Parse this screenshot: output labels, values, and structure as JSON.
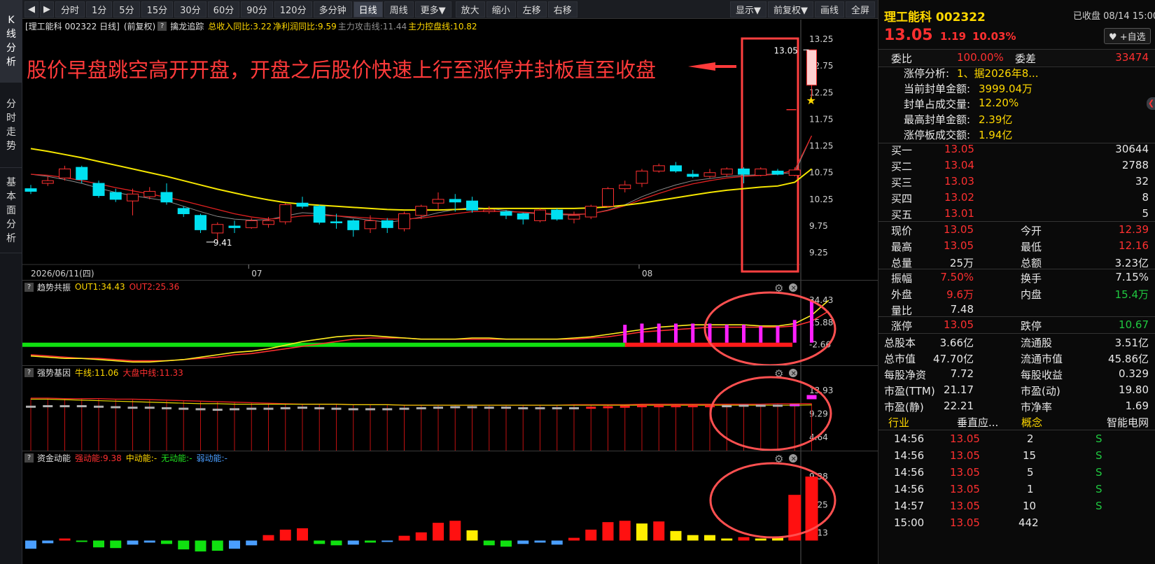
{
  "rail": {
    "items": [
      {
        "label": "K线分析",
        "chars": [
          "K",
          "线",
          "分",
          "析"
        ],
        "active": true
      },
      {
        "label": "分时走势",
        "chars": [
          "分",
          "时",
          "走",
          "势"
        ],
        "active": false
      },
      {
        "label": "基本面分析",
        "chars": [
          "基",
          "本",
          "面",
          "分",
          "析"
        ],
        "active": false
      }
    ]
  },
  "toolbar": {
    "periods": [
      "分时",
      "1分",
      "5分",
      "15分",
      "30分",
      "60分",
      "90分",
      "120分",
      "多分钟",
      "日线",
      "周线",
      "更多▼"
    ],
    "active_period": "日线",
    "actions": [
      "放大",
      "缩小",
      "左移",
      "右移"
    ],
    "right_actions": [
      "显示▼",
      "前复权▼",
      "画线",
      "全屏"
    ]
  },
  "header": {
    "stock": "[理工能科 002322 日线]",
    "adjust": "(前复权)",
    "indicator_name": "擒龙追踪",
    "values": [
      {
        "label": "总收入同比:3.22",
        "color": "#ffd800"
      },
      {
        "label": "净利润同比:9.59",
        "color": "#ffd800"
      },
      {
        "label": "主力攻击线:11.44",
        "color": "#909090"
      },
      {
        "label": "主力控盘线:10.82",
        "color": "#ffd800"
      }
    ]
  },
  "annotation": {
    "text": "股价早盘跳空高开开盘，开盘之后股价快速上行至涨停并封板直至收盘",
    "color": "#ff3a3a"
  },
  "chart_data": [
    {
      "type": "candlestick",
      "title": "理工能科 002322 日线",
      "ylim": [
        9.2,
        13.25
      ],
      "yticks": [
        13.25,
        12.75,
        12.25,
        11.75,
        11.25,
        10.75,
        10.25,
        9.75,
        9.25
      ],
      "xlabels": [
        {
          "i": 0,
          "label": "2026/06/11(四)"
        },
        {
          "i": 13,
          "label": "07"
        },
        {
          "i": 36,
          "label": "08"
        }
      ],
      "low_label": {
        "i": 11,
        "value": "9.41"
      },
      "last_label": "13.05",
      "candles": [
        {
          "o": 10.45,
          "c": 10.4,
          "h": 10.52,
          "l": 10.35
        },
        {
          "o": 10.55,
          "c": 10.6,
          "h": 10.68,
          "l": 10.5
        },
        {
          "o": 10.65,
          "c": 10.82,
          "h": 10.88,
          "l": 10.6
        },
        {
          "o": 10.85,
          "c": 10.62,
          "h": 10.88,
          "l": 10.55
        },
        {
          "o": 10.55,
          "c": 10.32,
          "h": 10.6,
          "l": 10.28
        },
        {
          "o": 10.38,
          "c": 10.25,
          "h": 10.45,
          "l": 10.2
        },
        {
          "o": 10.22,
          "c": 10.35,
          "h": 10.45,
          "l": 9.95
        },
        {
          "o": 10.3,
          "c": 10.4,
          "h": 10.48,
          "l": 10.25
        },
        {
          "o": 10.38,
          "c": 10.2,
          "h": 10.55,
          "l": 10.15
        },
        {
          "o": 10.08,
          "c": 9.98,
          "h": 10.12,
          "l": 9.92
        },
        {
          "o": 9.95,
          "c": 9.68,
          "h": 9.98,
          "l": 9.62
        },
        {
          "o": 9.62,
          "c": 9.78,
          "h": 9.82,
          "l": 9.45
        },
        {
          "o": 9.75,
          "c": 9.72,
          "h": 9.85,
          "l": 9.62
        },
        {
          "o": 9.72,
          "c": 9.85,
          "h": 9.9,
          "l": 9.7
        },
        {
          "o": 9.78,
          "c": 9.85,
          "h": 9.92,
          "l": 9.72
        },
        {
          "o": 9.83,
          "c": 10.15,
          "h": 10.18,
          "l": 9.78
        },
        {
          "o": 10.18,
          "c": 10.12,
          "h": 10.3,
          "l": 10.08
        },
        {
          "o": 10.12,
          "c": 9.82,
          "h": 10.15,
          "l": 9.78
        },
        {
          "o": 9.83,
          "c": 9.82,
          "h": 9.98,
          "l": 9.7
        },
        {
          "o": 9.85,
          "c": 9.68,
          "h": 9.88,
          "l": 9.55
        },
        {
          "o": 9.7,
          "c": 9.85,
          "h": 9.95,
          "l": 9.62
        },
        {
          "o": 9.85,
          "c": 9.72,
          "h": 9.9,
          "l": 9.62
        },
        {
          "o": 9.7,
          "c": 9.98,
          "h": 10.02,
          "l": 9.65
        },
        {
          "o": 9.95,
          "c": 10.12,
          "h": 10.15,
          "l": 9.88
        },
        {
          "o": 10.18,
          "c": 10.25,
          "h": 10.38,
          "l": 10.05
        },
        {
          "o": 10.25,
          "c": 10.2,
          "h": 10.35,
          "l": 10.02
        },
        {
          "o": 10.22,
          "c": 10.05,
          "h": 10.3,
          "l": 10.0
        },
        {
          "o": 10.02,
          "c": 10.05,
          "h": 10.12,
          "l": 9.98
        },
        {
          "o": 10.02,
          "c": 9.95,
          "h": 10.05,
          "l": 9.88
        },
        {
          "o": 9.98,
          "c": 9.88,
          "h": 10.0,
          "l": 9.78
        },
        {
          "o": 9.85,
          "c": 10.05,
          "h": 10.08,
          "l": 9.82
        },
        {
          "o": 10.05,
          "c": 9.88,
          "h": 10.08,
          "l": 9.85
        },
        {
          "o": 9.88,
          "c": 9.95,
          "h": 10.02,
          "l": 9.8
        },
        {
          "o": 9.92,
          "c": 10.12,
          "h": 10.15,
          "l": 9.88
        },
        {
          "o": 10.12,
          "c": 10.45,
          "h": 10.48,
          "l": 10.1
        },
        {
          "o": 10.45,
          "c": 10.52,
          "h": 10.6,
          "l": 10.38
        },
        {
          "o": 10.55,
          "c": 10.78,
          "h": 10.82,
          "l": 10.48
        },
        {
          "o": 10.78,
          "c": 10.88,
          "h": 10.92,
          "l": 10.75
        },
        {
          "o": 10.88,
          "c": 10.78,
          "h": 10.95,
          "l": 10.75
        },
        {
          "o": 10.72,
          "c": 10.68,
          "h": 10.8,
          "l": 10.65
        },
        {
          "o": 10.68,
          "c": 10.75,
          "h": 10.82,
          "l": 10.65
        },
        {
          "o": 10.72,
          "c": 10.82,
          "h": 10.85,
          "l": 10.68
        },
        {
          "o": 10.82,
          "c": 10.72,
          "h": 10.85,
          "l": 10.55
        },
        {
          "o": 10.7,
          "c": 10.82,
          "h": 10.85,
          "l": 10.68
        },
        {
          "o": 10.78,
          "c": 10.72,
          "h": 10.82,
          "l": 10.7
        },
        {
          "o": 10.7,
          "c": 10.8,
          "h": 10.85,
          "l": 10.68
        },
        {
          "o": 12.39,
          "c": 13.05,
          "h": 13.05,
          "l": 12.16
        }
      ],
      "ma_white": [
        10.72,
        10.68,
        10.62,
        10.55,
        10.46,
        10.38,
        10.32,
        10.27,
        10.22,
        10.12,
        10.02,
        9.93,
        9.88,
        9.86,
        9.87,
        9.94,
        10.0,
        9.98,
        9.94,
        9.9,
        9.86,
        9.82,
        9.86,
        9.92,
        10.0,
        10.06,
        10.1,
        10.08,
        10.04,
        10.0,
        9.98,
        9.96,
        9.96,
        9.98,
        10.05,
        10.15,
        10.3,
        10.42,
        10.52,
        10.6,
        10.64,
        10.68,
        10.7,
        10.71,
        10.73,
        10.75,
        11.44
      ],
      "ma_red": [
        10.72,
        10.7,
        10.66,
        10.6,
        10.54,
        10.47,
        10.41,
        10.35,
        10.29,
        10.22,
        10.14,
        10.06,
        9.98,
        9.92,
        9.88,
        9.9,
        9.94,
        9.95,
        9.94,
        9.92,
        9.9,
        9.88,
        9.88,
        9.9,
        9.94,
        9.98,
        10.02,
        10.03,
        10.02,
        10.01,
        9.99,
        9.98,
        9.97,
        9.98,
        10.04,
        10.13,
        10.25,
        10.36,
        10.46,
        10.54,
        10.6,
        10.65,
        10.68,
        10.7,
        10.72,
        10.8,
        11.44
      ],
      "ma_yellow": [
        11.2,
        11.15,
        11.09,
        11.03,
        10.96,
        10.89,
        10.82,
        10.75,
        10.68,
        10.6,
        10.52,
        10.44,
        10.37,
        10.3,
        10.24,
        10.19,
        10.16,
        10.14,
        10.12,
        10.1,
        10.08,
        10.06,
        10.05,
        10.05,
        10.05,
        10.06,
        10.07,
        10.08,
        10.08,
        10.08,
        10.08,
        10.08,
        10.08,
        10.09,
        10.11,
        10.14,
        10.18,
        10.23,
        10.28,
        10.33,
        10.38,
        10.42,
        10.45,
        10.48,
        10.5,
        10.57,
        10.82
      ]
    },
    {
      "type": "bar",
      "title": "趋势共振",
      "legend": [
        {
          "name": "OUT1:34.43",
          "color": "#ffd800"
        },
        {
          "name": "OUT2:25.36",
          "color": "#ff3030"
        }
      ],
      "ylim": [
        -10,
        40
      ],
      "yticks": [
        34.43,
        15.88,
        -2.66
      ],
      "out1": [
        -12,
        -13,
        -14,
        -14,
        -15,
        -16,
        -17,
        -17,
        -16,
        -15,
        -13,
        -11,
        -9,
        -8,
        -6,
        -3,
        0,
        2,
        4,
        5,
        5,
        4,
        3,
        2,
        2,
        2,
        3,
        3,
        2,
        2,
        2,
        2,
        3,
        4,
        6,
        8,
        10,
        12,
        13,
        14,
        14,
        14,
        14,
        13,
        13,
        15,
        22,
        34.43
      ],
      "out2": [
        -11,
        -12,
        -13,
        -14,
        -14,
        -15,
        -16,
        -16,
        -16,
        -15,
        -14,
        -13,
        -11,
        -10,
        -8,
        -6,
        -4,
        -2,
        0,
        2,
        3,
        3,
        3,
        2,
        2,
        2,
        2,
        2,
        2,
        2,
        2,
        2,
        2,
        3,
        4,
        6,
        8,
        9,
        10,
        11,
        12,
        12,
        12,
        12,
        12,
        13,
        17,
        25.36
      ],
      "bars": [
        14,
        15,
        15,
        15,
        15,
        15,
        14,
        14,
        13,
        13,
        18,
        34.43
      ],
      "bars_start": 35
    },
    {
      "type": "bar",
      "title": "强势基因",
      "legend": [
        {
          "name": "牛线:11.06",
          "color": "#ffd800"
        },
        {
          "name": "大盘中线:11.33",
          "color": "#ff3030"
        }
      ],
      "ylim": [
        2,
        16
      ],
      "yticks": [
        13.93,
        9.29,
        4.64
      ],
      "line_yellow": [
        12.2,
        12.2,
        12.1,
        12.0,
        11.9,
        11.8,
        11.7,
        11.6,
        11.5,
        11.4,
        11.3,
        11.3,
        11.2,
        11.2,
        11.2,
        11.2,
        11.2,
        11.2,
        11.2,
        11.1,
        11.1,
        11.1,
        11.0,
        11.0,
        11.0,
        11.0,
        11.0,
        11.0,
        11.0,
        11.0,
        11.0,
        11.0,
        11.0,
        11.0,
        11.0,
        11.0,
        11.0,
        11.0,
        11.0,
        11.0,
        11.0,
        11.0,
        11.0,
        11.0,
        11.0,
        11.0,
        11.06
      ],
      "line_red": [
        12.4,
        12.4,
        12.3,
        12.3,
        12.3,
        12.2,
        12.2,
        12.1,
        12.0,
        11.9,
        11.8,
        11.7,
        11.6,
        11.5,
        11.4,
        11.3,
        11.2,
        11.2,
        11.2,
        11.1,
        11.1,
        11.1,
        11.0,
        11.0,
        11.0,
        11.0,
        11.0,
        11.0,
        11.0,
        11.0,
        11.0,
        11.0,
        11.1,
        11.1,
        11.1,
        11.1,
        11.2,
        11.2,
        11.2,
        11.2,
        11.2,
        11.2,
        11.2,
        11.2,
        11.3,
        11.3,
        11.33
      ],
      "dash_gray": [
        10.7,
        10.8,
        10.8,
        10.8,
        10.7,
        10.6,
        10.5,
        10.5,
        10.4,
        10.3,
        10.2,
        10.1,
        10.2,
        10.3,
        10.3,
        10.4,
        10.5,
        10.4,
        10.3,
        10.2,
        10.2,
        10.2,
        10.3,
        10.4,
        10.5,
        10.6,
        10.6,
        10.5,
        10.5,
        10.4,
        10.4,
        10.4,
        10.4,
        10.5,
        10.6,
        10.7,
        10.8,
        10.8,
        10.8,
        10.8,
        10.8,
        10.8,
        10.9,
        10.9,
        10.9,
        11.0
      ],
      "last_dash": 12.6
    },
    {
      "type": "bar",
      "title": "资金动能",
      "legend": [
        {
          "name": "强动能:9.38",
          "color": "#ff3030"
        },
        {
          "name": "中动能:-",
          "color": "#ffd800"
        },
        {
          "name": "无动能:-",
          "color": "#20e020"
        },
        {
          "name": "弱动能:-",
          "color": "#4a9eff"
        }
      ],
      "ylim": [
        -1.6,
        10
      ],
      "yticks": [
        9.38,
        5.25,
        1.13
      ],
      "values": [
        -1.2,
        -0.4,
        0.3,
        -0.2,
        -1.0,
        -1.1,
        -0.6,
        -0.3,
        -0.5,
        -1.3,
        -1.6,
        -1.5,
        -1.2,
        -0.7,
        0.8,
        1.6,
        1.8,
        -0.5,
        -0.7,
        -0.6,
        -0.3,
        -0.2,
        0.7,
        1.2,
        2.6,
        2.9,
        1.5,
        -0.7,
        -0.9,
        -0.5,
        -0.3,
        -0.6,
        0.4,
        1.6,
        2.7,
        2.9,
        2.5,
        2.8,
        1.4,
        0.8,
        0.8,
        0.3,
        0.5,
        0.3,
        0.5,
        6.7,
        9.38
      ],
      "kinds": [
        "weak",
        "weak",
        "strong",
        "none",
        "none",
        "none",
        "weak",
        "weak",
        "none",
        "none",
        "none",
        "none",
        "weak",
        "weak",
        "strong",
        "strong",
        "strong",
        "none",
        "none",
        "weak",
        "none",
        "weak",
        "strong",
        "strong",
        "strong",
        "strong",
        "mid",
        "none",
        "none",
        "weak",
        "weak",
        "weak",
        "strong",
        "strong",
        "strong",
        "strong",
        "mid",
        "strong",
        "mid",
        "mid",
        "mid",
        "mid",
        "strong",
        "mid",
        "mid",
        "strong",
        "strong"
      ]
    }
  ],
  "panels": {
    "trend": {
      "name": "趋势共振"
    },
    "gene": {
      "name": "强势基因"
    },
    "fund": {
      "name": "资金动能"
    }
  },
  "right": {
    "name": "理工能科 002322",
    "status": "已收盘 08/14 15:00",
    "price": "13.05",
    "change": "1.19",
    "pct": "10.03%",
    "watch_btn": "♥ +自选",
    "weibi_label": "委比",
    "weibi": "100.00%",
    "weicha_label": "委差",
    "weicha": "33474",
    "limit_info": [
      {
        "label": "涨停分析:",
        "value": "1、据2026年8..."
      },
      {
        "label": "当前封单金额:",
        "value": "3999.04万"
      },
      {
        "label": "封单占成交量:",
        "value": "12.20%"
      },
      {
        "label": "最高封单金额:",
        "value": "2.39亿"
      },
      {
        "label": "涨停板成交额:",
        "value": "1.94亿"
      }
    ],
    "bids": [
      {
        "label": "买一",
        "price": "13.05",
        "vol": "30644"
      },
      {
        "label": "买二",
        "price": "13.04",
        "vol": "2788"
      },
      {
        "label": "买三",
        "price": "13.03",
        "vol": "32"
      },
      {
        "label": "买四",
        "price": "13.02",
        "vol": "8"
      },
      {
        "label": "买五",
        "price": "13.01",
        "vol": "5"
      }
    ],
    "stats1": [
      {
        "l1": "现价",
        "v1": "13.05",
        "c1": "red",
        "l2": "今开",
        "v2": "12.39",
        "c2": "red"
      },
      {
        "l1": "最高",
        "v1": "13.05",
        "c1": "red",
        "l2": "最低",
        "v2": "12.16",
        "c2": "red"
      },
      {
        "l1": "总量",
        "v1": "25万",
        "c1": "white",
        "l2": "总额",
        "v2": "3.23亿",
        "c2": "white"
      }
    ],
    "stats2": [
      {
        "l1": "振幅",
        "v1": "7.50%",
        "c1": "red",
        "l2": "换手",
        "v2": "7.15%",
        "c2": "white"
      },
      {
        "l1": "外盘",
        "v1": "9.6万",
        "c1": "red",
        "l2": "内盘",
        "v2": "15.4万",
        "c2": "green"
      },
      {
        "l1": "量比",
        "v1": "7.48",
        "c1": "white",
        "l2": "",
        "v2": "",
        "c2": "white"
      }
    ],
    "stats3": [
      {
        "l1": "涨停",
        "v1": "13.05",
        "c1": "red",
        "l2": "跌停",
        "v2": "10.67",
        "c2": "green"
      }
    ],
    "stats4": [
      {
        "l1": "总股本",
        "v1": "3.66亿",
        "c1": "white",
        "l2": "流通股",
        "v2": "3.51亿",
        "c2": "white"
      },
      {
        "l1": "总市值",
        "v1": "47.70亿",
        "c1": "white",
        "l2": "流通市值",
        "v2": "45.86亿",
        "c2": "white"
      },
      {
        "l1": "每股净资",
        "v1": "7.72",
        "c1": "white",
        "l2": "每股收益",
        "v2": "0.329",
        "c2": "white"
      },
      {
        "l1": "市盈(TTM)",
        "v1": "21.17",
        "c1": "white",
        "l2": "市盈(动)",
        "v2": "19.80",
        "c2": "white"
      },
      {
        "l1": "市盈(静)",
        "v1": "22.21",
        "c1": "white",
        "l2": "市净率",
        "v2": "1.69",
        "c2": "white"
      }
    ],
    "industry": {
      "l1": "行业",
      "v1": "垂直应...",
      "l2": "概念",
      "v2": "智能电网"
    },
    "ticks": [
      {
        "time": "14:56",
        "price": "13.05",
        "vol": "2",
        "side": "S"
      },
      {
        "time": "14:56",
        "price": "13.05",
        "vol": "15",
        "side": "S"
      },
      {
        "time": "14:56",
        "price": "13.05",
        "vol": "5",
        "side": "S"
      },
      {
        "time": "14:56",
        "price": "13.05",
        "vol": "1",
        "side": "S"
      },
      {
        "time": "14:57",
        "price": "13.05",
        "vol": "10",
        "side": "S"
      },
      {
        "time": "15:00",
        "price": "13.05",
        "vol": "442",
        "side": ""
      }
    ]
  }
}
